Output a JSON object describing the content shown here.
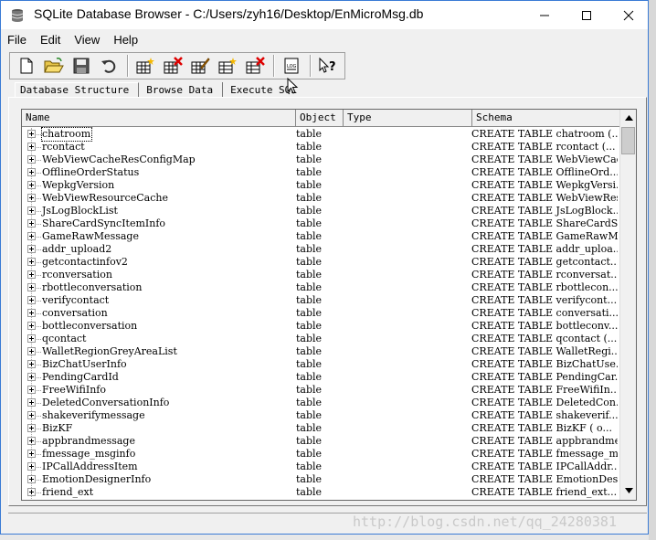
{
  "window": {
    "title": "SQLite Database Browser - C:/Users/zyh16/Desktop/EnMicroMsg.db"
  },
  "menu": [
    "File",
    "Edit",
    "View",
    "Help"
  ],
  "toolbar_buttons": [
    {
      "name": "new-database-icon"
    },
    {
      "name": "open-database-icon"
    },
    {
      "name": "save-changes-icon"
    },
    {
      "name": "revert-changes-icon"
    },
    {
      "name": "create-table-icon"
    },
    {
      "name": "delete-table-icon"
    },
    {
      "name": "modify-table-icon"
    },
    {
      "name": "create-index-icon"
    },
    {
      "name": "delete-index-icon"
    },
    {
      "name": "sql-log-icon"
    },
    {
      "name": "whats-this-icon"
    }
  ],
  "tabs": [
    "Database Structure",
    "Browse Data",
    "Execute SQL"
  ],
  "table": {
    "columns": [
      "Name",
      "Object",
      "Type",
      "Schema"
    ],
    "rows": [
      {
        "name": "chatroom",
        "object": "table",
        "schema": "CREATE TABLE chatroom (..."
      },
      {
        "name": "rcontact",
        "object": "table",
        "schema": "CREATE TABLE rcontact (..."
      },
      {
        "name": "WebViewCacheResConfigMap",
        "object": "table",
        "schema": "CREATE TABLE WebViewCac..."
      },
      {
        "name": "OfflineOrderStatus",
        "object": "table",
        "schema": "CREATE TABLE OfflineOrd..."
      },
      {
        "name": "WepkgVersion",
        "object": "table",
        "schema": "CREATE TABLE WepkgVersi..."
      },
      {
        "name": "WebViewResourceCache",
        "object": "table",
        "schema": "CREATE TABLE WebViewRes..."
      },
      {
        "name": "JsLogBlockList",
        "object": "table",
        "schema": "CREATE TABLE JsLogBlock..."
      },
      {
        "name": "ShareCardSyncItemInfo",
        "object": "table",
        "schema": "CREATE TABLE ShareCardS..."
      },
      {
        "name": "GameRawMessage",
        "object": "table",
        "schema": "CREATE TABLE GameRawMes..."
      },
      {
        "name": "addr_upload2",
        "object": "table",
        "schema": "CREATE TABLE addr_uploa..."
      },
      {
        "name": "getcontactinfov2",
        "object": "table",
        "schema": "CREATE TABLE getcontact..."
      },
      {
        "name": "rconversation",
        "object": "table",
        "schema": "CREATE TABLE rconversat..."
      },
      {
        "name": "rbottleconversation",
        "object": "table",
        "schema": "CREATE TABLE rbottlecon..."
      },
      {
        "name": "verifycontact",
        "object": "table",
        "schema": "CREATE TABLE verifycont..."
      },
      {
        "name": "conversation",
        "object": "table",
        "schema": "CREATE TABLE conversati..."
      },
      {
        "name": "bottleconversation",
        "object": "table",
        "schema": "CREATE TABLE bottleconv..."
      },
      {
        "name": "qcontact",
        "object": "table",
        "schema": "CREATE TABLE qcontact (..."
      },
      {
        "name": "WalletRegionGreyAreaList",
        "object": "table",
        "schema": "CREATE TABLE WalletRegi..."
      },
      {
        "name": "BizChatUserInfo",
        "object": "table",
        "schema": "CREATE TABLE BizChatUse..."
      },
      {
        "name": "PendingCardId",
        "object": "table",
        "schema": "CREATE TABLE PendingCar..."
      },
      {
        "name": "FreeWifiInfo",
        "object": "table",
        "schema": "CREATE TABLE FreeWifiIn..."
      },
      {
        "name": "DeletedConversationInfo",
        "object": "table",
        "schema": "CREATE TABLE DeletedCon..."
      },
      {
        "name": "shakeverifymessage",
        "object": "table",
        "schema": "CREATE TABLE shakeverif..."
      },
      {
        "name": "BizKF",
        "object": "table",
        "schema": "CREATE TABLE BizKF (  o..."
      },
      {
        "name": "appbrandmessage",
        "object": "table",
        "schema": "CREATE TABLE appbrandme..."
      },
      {
        "name": "fmessage_msginfo",
        "object": "table",
        "schema": "CREATE TABLE fmessage_m..."
      },
      {
        "name": "IPCallAddressItem",
        "object": "table",
        "schema": "CREATE TABLE IPCallAddr..."
      },
      {
        "name": "EmotionDesignerInfo",
        "object": "table",
        "schema": "CREATE TABLE EmotionDes..."
      },
      {
        "name": "friend_ext",
        "object": "table",
        "schema": "CREATE TABLE friend_ext..."
      }
    ]
  },
  "watermark": "http://blog.csdn.net/qq_24280381",
  "colors": {
    "window_bg": "#f0f0f0",
    "title_bg": "#ffffff",
    "border_accent": "#3a7bd5"
  }
}
